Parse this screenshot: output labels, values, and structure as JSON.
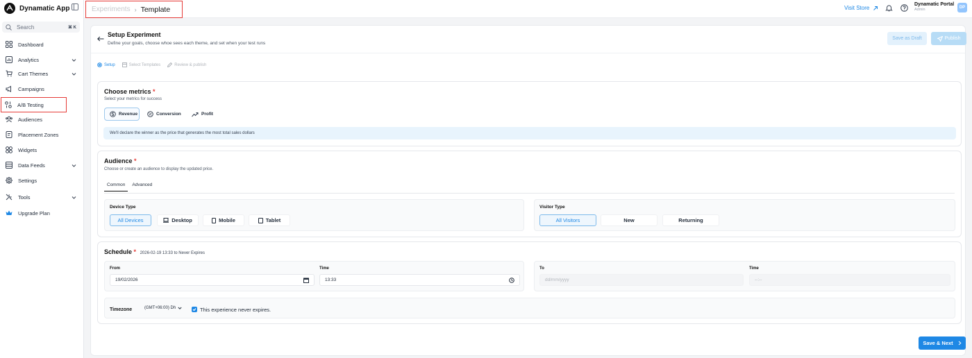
{
  "app": {
    "name": "Dynamatic App"
  },
  "search": {
    "placeholder": "Search",
    "shortcut": "⌘ K"
  },
  "sidebar": {
    "items": [
      {
        "label": "Dashboard",
        "icon": "grid-icon"
      },
      {
        "label": "Analytics",
        "icon": "chart-icon",
        "expandable": true
      },
      {
        "label": "Cart Themes",
        "icon": "cart-icon",
        "expandable": true
      },
      {
        "label": "Campaigns",
        "icon": "megaphone-icon"
      },
      {
        "label": "A/B Testing",
        "icon": "ab-test-icon",
        "active": true
      },
      {
        "label": "Audiences",
        "icon": "users-icon"
      },
      {
        "label": "Placement Zones",
        "icon": "placement-icon"
      },
      {
        "label": "Widgets",
        "icon": "widgets-icon"
      },
      {
        "label": "Data Feeds",
        "icon": "database-icon",
        "expandable": true
      },
      {
        "label": "Settings",
        "icon": "gear-icon"
      },
      {
        "label": "Tools",
        "icon": "tools-icon",
        "expandable": true
      },
      {
        "label": "Upgrade Plan",
        "icon": "crown-icon"
      }
    ]
  },
  "breadcrumb": {
    "parent": "Experiments",
    "current": "Template"
  },
  "header": {
    "visit_store": "Visit Store",
    "portal_name": "Dynamatic Portal",
    "portal_role": "Admin",
    "avatar_initials": "DP"
  },
  "page": {
    "title": "Setup Experiment",
    "subtitle": "Define your goals, choose whoe sees each theme, and set when your test runs",
    "save_draft": "Save as Draft",
    "publish": "Publish"
  },
  "steps": [
    {
      "label": "Setup",
      "active": true
    },
    {
      "label": "Select Templates",
      "active": false
    },
    {
      "label": "Review & publish",
      "active": false
    }
  ],
  "metrics": {
    "title": "Choose metrics",
    "required_mark": "*",
    "subtitle": "Select your metrics for success",
    "options": [
      {
        "label": "Revenue",
        "active": true
      },
      {
        "label": "Conversion",
        "active": false
      },
      {
        "label": "Profit",
        "active": false
      }
    ],
    "info": "We'll declare the winner as the price that generates the most total sales dollars"
  },
  "audience": {
    "title": "Audience",
    "required_mark": "*",
    "subtitle": "Choose or create an audience to display the updated price.",
    "tabs": [
      {
        "label": "Common",
        "active": true
      },
      {
        "label": "Advanced",
        "active": false
      }
    ],
    "device_type": {
      "label": "Device Type",
      "options": [
        {
          "label": "All Devices",
          "active": true
        },
        {
          "label": "Desktop",
          "active": false
        },
        {
          "label": "Mobile",
          "active": false
        },
        {
          "label": "Tablet",
          "active": false
        }
      ]
    },
    "visitor_type": {
      "label": "Visitor Type",
      "options": [
        {
          "label": "All Visitors",
          "active": true
        },
        {
          "label": "New",
          "active": false
        },
        {
          "label": "Returning",
          "active": false
        }
      ]
    }
  },
  "schedule": {
    "title": "Schedule",
    "required_mark": "*",
    "range": "2026-02-19 13:33 to Never Expires",
    "from_label": "From",
    "from_value": "19/02/2026",
    "from_time_label": "Time",
    "from_time_value": "13:33",
    "to_label": "To",
    "to_placeholder": "dd/mm/yyyy",
    "to_time_label": "Time",
    "to_time_placeholder": "--:--",
    "timezone_label": "Timezone",
    "timezone_value": "(GMT+06:00) Dh",
    "never_expires_label": "This experience never expires.",
    "never_expires_checked": true
  },
  "footer": {
    "next": "Save & Next"
  },
  "colors": {
    "accent": "#1e88e5",
    "highlight_border": "#e53935",
    "info_bg": "#e8f4fd"
  }
}
